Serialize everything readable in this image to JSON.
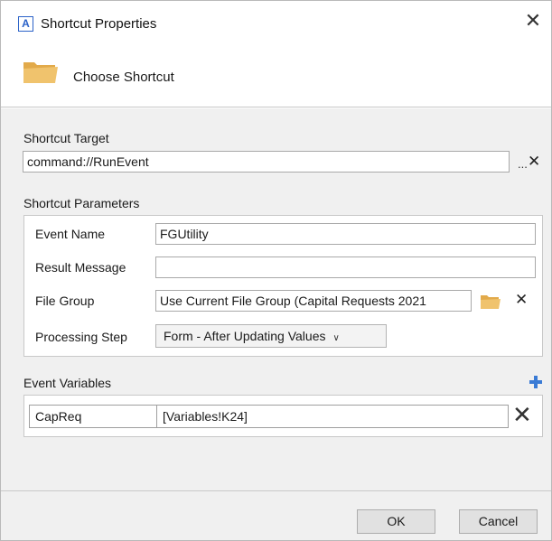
{
  "window": {
    "app_icon_letter": "A",
    "title": "Shortcut Properties",
    "close_glyph": "✕"
  },
  "header": {
    "icon": "folder-icon",
    "title": "Choose Shortcut"
  },
  "shortcut_target": {
    "label": "Shortcut Target",
    "value": "command://RunEvent",
    "browse_label": "...",
    "clear_glyph": "✕"
  },
  "shortcut_parameters": {
    "group_label": "Shortcut Parameters",
    "event_name": {
      "label": "Event Name",
      "value": "FGUtility"
    },
    "result_message": {
      "label": "Result Message",
      "value": ""
    },
    "file_group": {
      "label": "File Group",
      "value": "Use Current File Group (Capital Requests 2021",
      "clear_glyph": "✕"
    },
    "processing_step": {
      "label": "Processing Step",
      "value": "Form - After Updating Values",
      "chevron": "∨"
    }
  },
  "event_variables": {
    "label": "Event Variables",
    "rows": [
      {
        "name": "CapReq",
        "value": "[Variables!K24]"
      }
    ],
    "remove_glyph": "✕"
  },
  "footer": {
    "ok_label": "OK",
    "cancel_label": "Cancel"
  },
  "colors": {
    "folder": "#f0c36d",
    "folder_dark": "#e2aa4a",
    "accent_blue": "#2b62c8",
    "plus_blue": "#3a7bd5",
    "panel_bg": "#f0f0f0"
  }
}
